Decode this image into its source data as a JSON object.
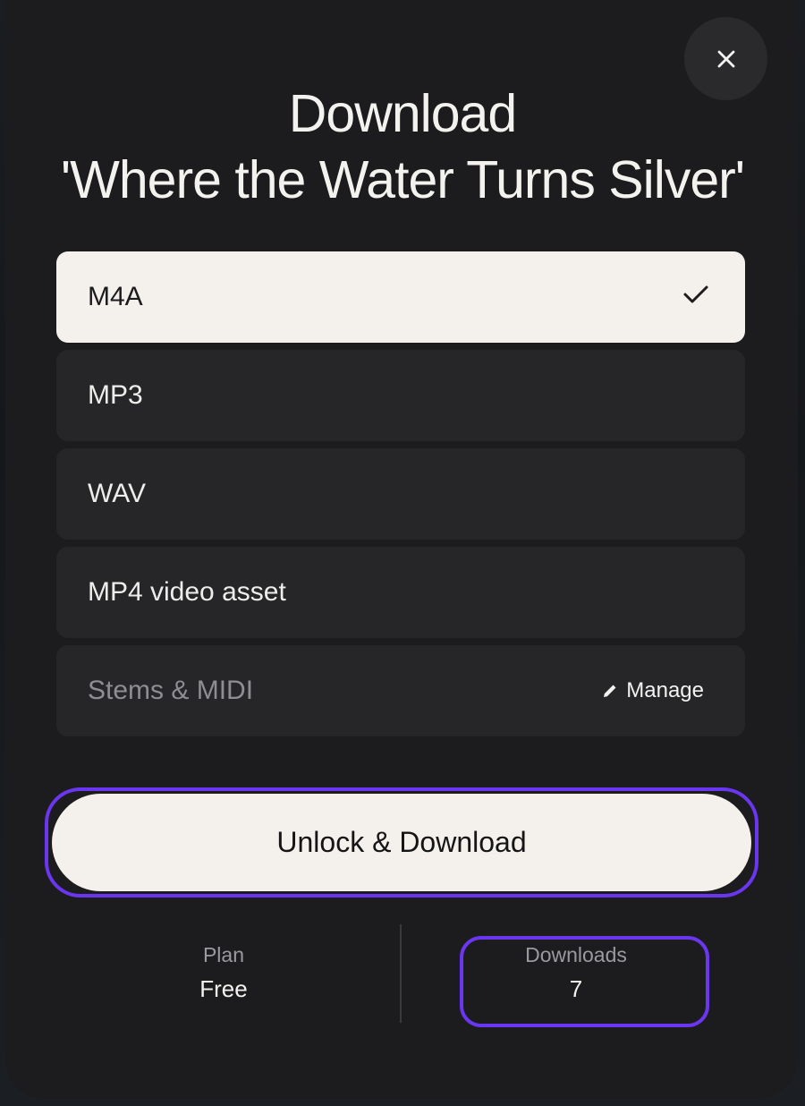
{
  "dialog": {
    "title_line1": "Download",
    "title_line2": "'Where the Water Turns Silver'",
    "close_icon": "close-icon"
  },
  "formats": [
    {
      "label": "M4A",
      "selected": true
    },
    {
      "label": "MP3",
      "selected": false
    },
    {
      "label": "WAV",
      "selected": false
    },
    {
      "label": "MP4 video asset",
      "selected": false
    },
    {
      "label": "Stems & MIDI",
      "selected": false,
      "action_label": "Manage",
      "action_icon": "pencil-icon"
    }
  ],
  "cta": {
    "label": "Unlock & Download"
  },
  "stats": {
    "plan_label": "Plan",
    "plan_value": "Free",
    "downloads_label": "Downloads",
    "downloads_value": "7"
  },
  "colors": {
    "modal_bg": "#1c1c1e",
    "option_bg": "#262628",
    "selected_bg": "#f4f1ec",
    "highlight": "#6a36f0"
  }
}
